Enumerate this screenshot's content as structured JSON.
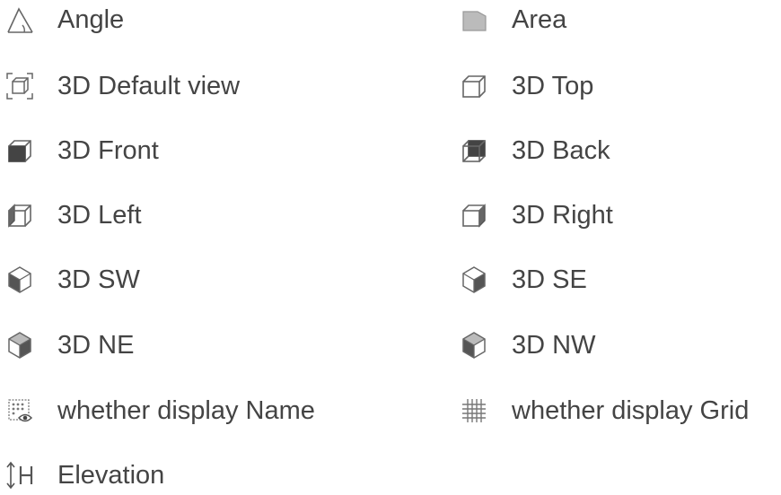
{
  "legend": {
    "angle": {
      "label": "Angle",
      "icon": "angle-icon"
    },
    "area": {
      "label": "Area",
      "icon": "area-icon"
    },
    "default_view": {
      "label": "3D Default view",
      "icon": "3d-default-view-icon"
    },
    "top": {
      "label": "3D Top",
      "icon": "3d-top-icon"
    },
    "front": {
      "label": "3D Front",
      "icon": "3d-front-icon"
    },
    "back": {
      "label": "3D Back",
      "icon": "3d-back-icon"
    },
    "left": {
      "label": "3D Left",
      "icon": "3d-left-icon"
    },
    "right": {
      "label": "3D Right",
      "icon": "3d-right-icon"
    },
    "sw": {
      "label": "3D SW",
      "icon": "3d-sw-icon"
    },
    "se": {
      "label": "3D SE",
      "icon": "3d-se-icon"
    },
    "ne": {
      "label": "3D NE",
      "icon": "3d-ne-icon"
    },
    "nw": {
      "label": "3D NW",
      "icon": "3d-nw-icon"
    },
    "display_name": {
      "label": "whether display Name",
      "icon": "display-name-icon"
    },
    "display_grid": {
      "label": "whether display Grid",
      "icon": "grid-icon"
    },
    "elevation": {
      "label": "Elevation",
      "icon": "elevation-icon"
    }
  },
  "colors": {
    "text": "#444444",
    "icon_stroke": "#555555",
    "icon_fill_dark": "#444444",
    "icon_fill_light": "#bbbbbb"
  }
}
